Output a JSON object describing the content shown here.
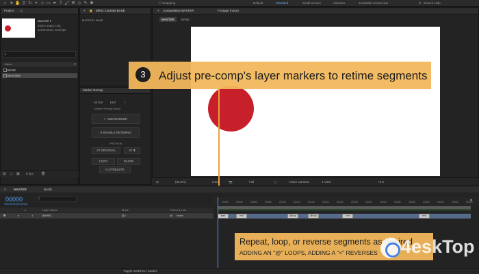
{
  "toolbar": {
    "snapping_label": "Snapping",
    "workspaces": [
      "Default",
      "Standard",
      "Small Screen",
      "Libraries"
    ],
    "active_workspace": "Standard",
    "screen_label": "1440x900 screencast",
    "search_placeholder": "Search Help"
  },
  "project": {
    "tab_label": "Project",
    "comp_name": "MASTER ▾",
    "comp_size": "1920 x 1080 (1.00)",
    "comp_duration": "Δ 0:00:45:00, 24.00 fps",
    "column_name": "Name",
    "items": [
      {
        "label": "BASE",
        "selected": false
      },
      {
        "label": "MASTER",
        "selected": true
      }
    ],
    "bpc_label": "8 bpc"
  },
  "effects": {
    "tab_label": "Effect Controls BASE",
    "breadcrumb": "MASTER • BASE"
  },
  "marker_remap": {
    "tab_label": "Marker Remap",
    "tabs": [
      "SETUP",
      "EDIT",
      "?"
    ],
    "subtitle": "Marker Remap (beta)",
    "add_marker": "✓ ADD MARKER",
    "enable_retiming": "↺ ENABLE RETIMING",
    "preview_label": "PREVIEW",
    "at_original": "AT ORIGINAL",
    "at_other": "AT ⧗",
    "copy": "COPY",
    "paste": "PASTE",
    "cut_delete": "CUT/DELETE"
  },
  "composition": {
    "tab_label": "Composition MASTER",
    "footage_label": "Footage (none)",
    "breadcrumbs": [
      "MASTER",
      "BASE"
    ],
    "zoom": "(43.2%)",
    "timecode": "0:00",
    "resolution": "Full",
    "camera": "Active Camera",
    "views": "1 View",
    "exposure": "+0.0"
  },
  "callouts": {
    "step_number": "3",
    "step_text": "Adjust pre-comp's layer markers to retime segments",
    "main_text": "Repeat, loop, or reverse segments as desired",
    "sub_text": "ADDING AN \"@\" LOOPS, ADDING A \"<\" REVERSES"
  },
  "timeline": {
    "tabs": [
      "MASTER",
      "BASE"
    ],
    "timecode": "00000",
    "timecode_sub": "0:00:00:00 (24.00 fps)",
    "columns": [
      "#",
      "Layer Name",
      "Mode",
      "Parent & Link"
    ],
    "layer": {
      "index": "1",
      "name": "[BASE]",
      "parent": "None"
    },
    "ruler_ticks": [
      "00020",
      "00040",
      "00060",
      "00080",
      "00100",
      "00120",
      "00140",
      "00160",
      "00180",
      "00200",
      "00220",
      "00240",
      "00260",
      "00280",
      "00300",
      "00320",
      "00340",
      "00360"
    ],
    "markers": [
      "start",
      "end",
      "@loop",
      "@loop",
      "<rev",
      "end"
    ],
    "toggle_label": "Toggle Switches / Modes"
  },
  "watermark": {
    "text": "4eskTop"
  },
  "colors": {
    "accent_blue": "#4fa3ff",
    "callout": "#f2b85c",
    "circle_red": "#c8202a"
  }
}
